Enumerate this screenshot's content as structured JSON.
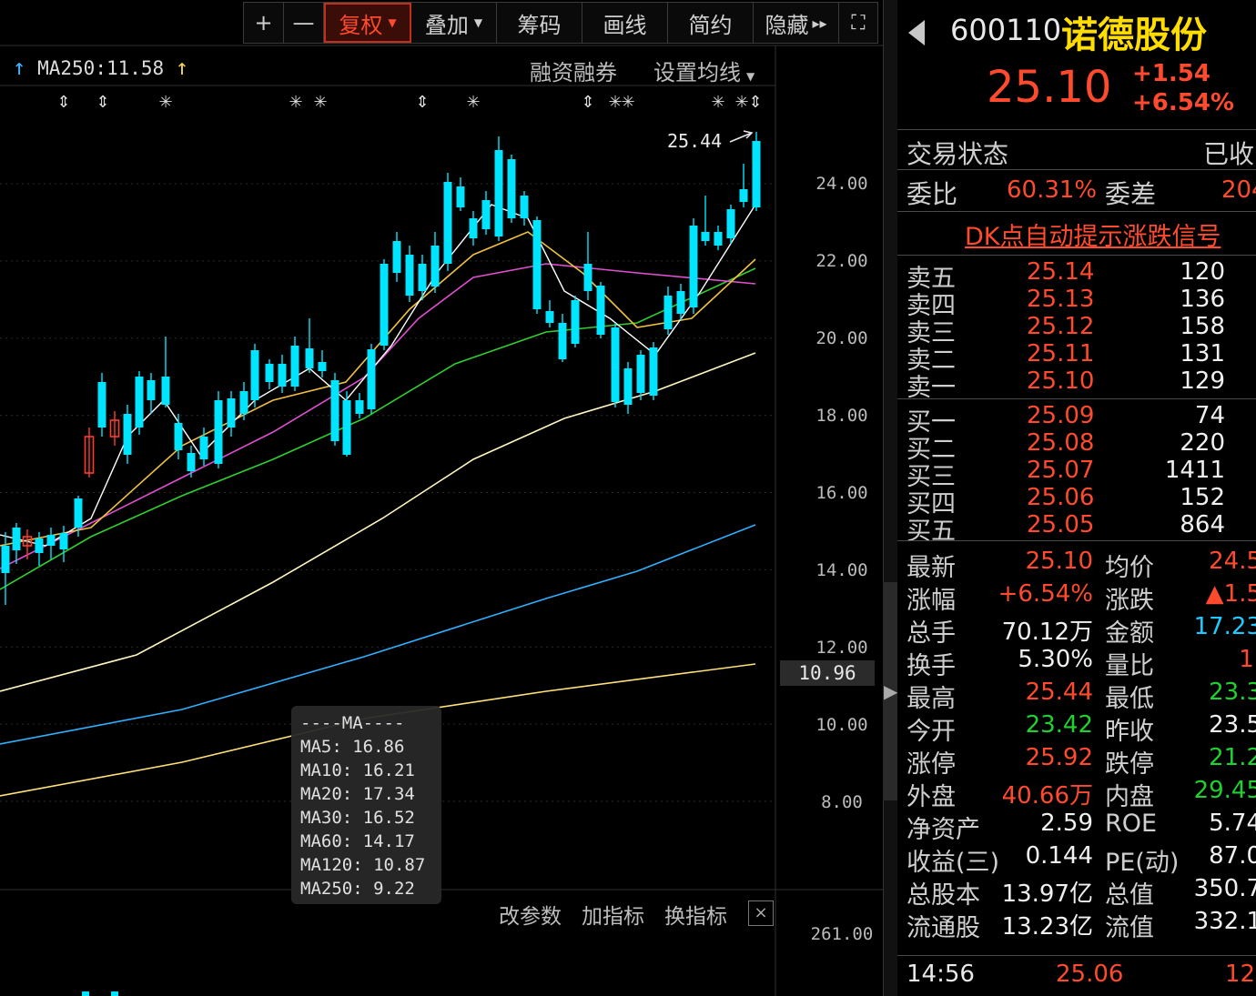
{
  "toolbar": {
    "plus": "+",
    "minus": "—",
    "fuquan": "复权",
    "overlay": "叠加",
    "chips": "筹码",
    "draw": "画线",
    "simple": "简约",
    "hide": "隐藏",
    "hide_arrows": "▸▸",
    "fullscreen": "⛶"
  },
  "chart_header": {
    "ma250_label": "MA250:11.58",
    "margin": "融资融券",
    "ma_settings": "设置均线"
  },
  "chart": {
    "high_label": "25.44",
    "y_ticks": [
      "24.00",
      "22.00",
      "20.00",
      "18.00",
      "16.00",
      "14.00",
      "12.00",
      "10.00",
      "8.00"
    ],
    "price_tag": "10.96",
    "sub_value": "261.00",
    "colors": {
      "up": "#ff3b2f",
      "down": "#00e4ff",
      "ma5": "#ffffff",
      "ma10": "#f0c040",
      "ma20": "#e050d0",
      "ma30": "#30d030",
      "ma60": "#fff6c0",
      "ma120": "#30b0ff",
      "ma250": "#ffe27a"
    }
  },
  "ma_tooltip": {
    "title": "----MA----",
    "ma5": "MA5: 16.86",
    "ma10": "MA10: 16.21",
    "ma20": "MA20: 17.34",
    "ma30": "MA30: 16.52",
    "ma60": "MA60: 14.17",
    "ma120": "MA120: 10.87",
    "ma250": "MA250: 9.22"
  },
  "sub_toolbar": {
    "edit_params": "改参数",
    "add_indicator": "加指标",
    "switch_indicator": "换指标",
    "close": "×"
  },
  "stock": {
    "code": "600110",
    "name": "诺德股份",
    "price": "25.10",
    "change": "+1.54",
    "change_pct": "+6.54%"
  },
  "status": {
    "label": "交易状态",
    "value": "已收"
  },
  "weibi": {
    "label": "委比",
    "value": "60.31%",
    "diff_label": "委差",
    "diff_value": "204"
  },
  "dk_link": "DK点自动提示涨跌信号",
  "order_book": {
    "asks": [
      {
        "label": "卖五",
        "price": "25.14",
        "vol": "120"
      },
      {
        "label": "卖四",
        "price": "25.13",
        "vol": "136"
      },
      {
        "label": "卖三",
        "price": "25.12",
        "vol": "158"
      },
      {
        "label": "卖二",
        "price": "25.11",
        "vol": "131"
      },
      {
        "label": "卖一",
        "price": "25.10",
        "vol": "129"
      }
    ],
    "bids": [
      {
        "label": "买一",
        "price": "25.09",
        "vol": "74"
      },
      {
        "label": "买二",
        "price": "25.08",
        "vol": "220"
      },
      {
        "label": "买三",
        "price": "25.07",
        "vol": "1411"
      },
      {
        "label": "买四",
        "price": "25.06",
        "vol": "152"
      },
      {
        "label": "买五",
        "price": "25.05",
        "vol": "864"
      }
    ]
  },
  "quote": [
    {
      "l1": "最新",
      "v1": "25.10",
      "l2": "均价",
      "v2": "24.5"
    },
    {
      "l1": "涨幅",
      "v1": "+6.54%",
      "l2": "涨跌",
      "v2": "▲1.5"
    },
    {
      "l1": "总手",
      "v1": "70.12万",
      "l2": "金额",
      "v2": "17.23"
    },
    {
      "l1": "换手",
      "v1": "5.30%",
      "l2": "量比",
      "v2": "1."
    },
    {
      "l1": "最高",
      "v1": "25.44",
      "l2": "最低",
      "v2": "23.3"
    },
    {
      "l1": "今开",
      "v1": "23.42",
      "l2": "昨收",
      "v2": "23.5"
    },
    {
      "l1": "涨停",
      "v1": "25.92",
      "l2": "跌停",
      "v2": "21.2"
    },
    {
      "l1": "外盘",
      "v1": "40.66万",
      "l2": "内盘",
      "v2": "29.45"
    },
    {
      "l1": "净资产",
      "v1": "2.59",
      "l2": "ROE",
      "v2": "5.74"
    },
    {
      "l1": "收益(三)",
      "v1": "0.144",
      "l2": "PE(动)",
      "v2": "87.0"
    },
    {
      "l1": "总股本",
      "v1": "13.97亿",
      "l2": "总值",
      "v2": "350.7"
    },
    {
      "l1": "流通股",
      "v1": "13.23亿",
      "l2": "流值",
      "v2": "332.1"
    }
  ],
  "last_tick": {
    "time": "14:56",
    "price": "25.06",
    "vol": "12"
  }
}
